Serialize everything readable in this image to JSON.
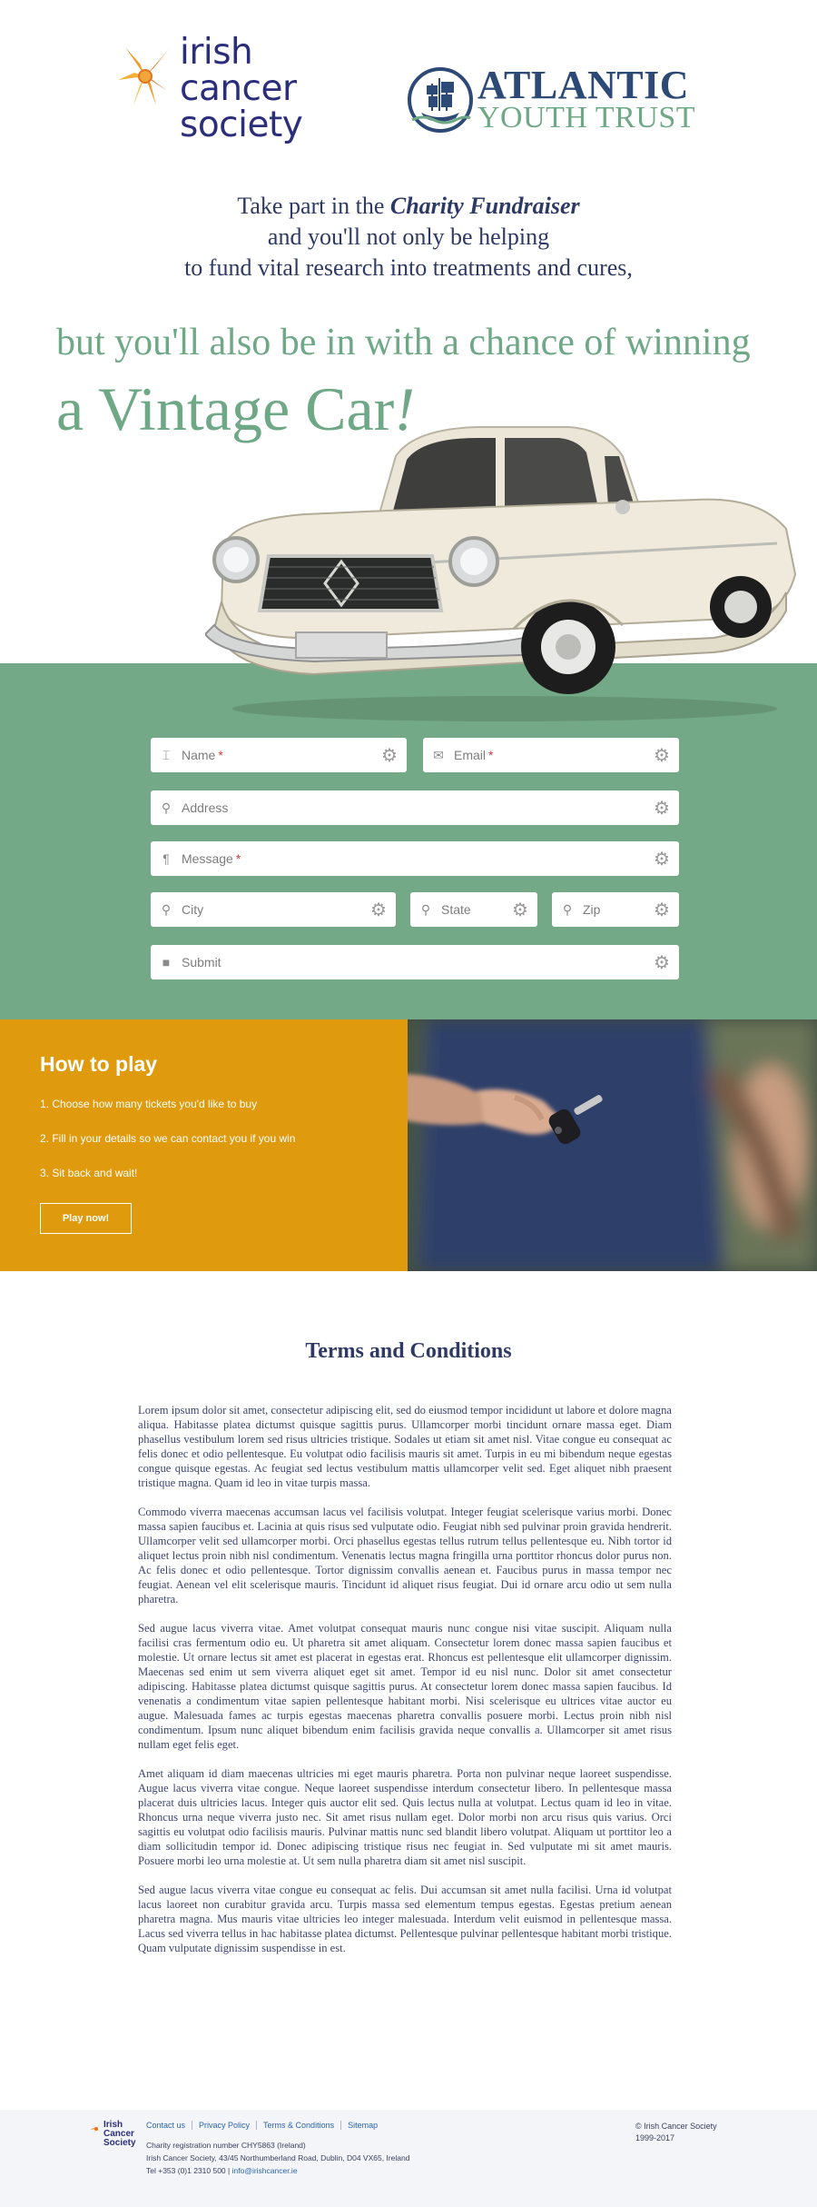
{
  "header": {
    "ics_logo_lines": [
      "irish",
      "cancer",
      "society"
    ],
    "aty_title": "ATLANTIC",
    "aty_subtitle": "YOUTH TRUST"
  },
  "intro": {
    "line1_prefix": "Take part in the",
    "line1_emphasis": "Charity Fundraiser",
    "line2": "and you'll not only be helping",
    "line3": "to fund vital research into treatments and cures,"
  },
  "tagline": "but you'll also be in with a chance of winning",
  "headline": {
    "text": "a Vintage Car",
    "bang": "!"
  },
  "form": {
    "name_label": "Name",
    "email_label": "Email",
    "address_label": "Address",
    "message_label": "Message",
    "city_label": "City",
    "state_label": "State",
    "zip_label": "Zip",
    "submit_label": "Submit",
    "required_mark": "*"
  },
  "howto": {
    "title": "How to play",
    "steps": [
      "1. Choose how many tickets you'd like to buy",
      "2. Fill in your details so we can contact you if you win",
      "3. Sit back and wait!"
    ],
    "button_label": "Play now!"
  },
  "terms": {
    "title": "Terms and Conditions",
    "paragraphs": [
      "Lorem ipsum dolor sit amet, consectetur adipiscing elit, sed do eiusmod tempor incididunt ut labore et dolore magna aliqua. Habitasse platea dictumst quisque sagittis purus. Ullamcorper morbi tincidunt ornare massa eget. Diam phasellus vestibulum lorem sed risus ultricies tristique. Sodales ut etiam sit amet nisl. Vitae congue eu consequat ac felis donec et odio pellentesque. Eu volutpat odio facilisis mauris sit amet. Turpis in eu mi bibendum neque egestas congue quisque egestas. Ac feugiat sed lectus vestibulum mattis ullamcorper velit sed. Eget aliquet nibh praesent tristique magna. Quam id leo in vitae turpis massa.",
      "Commodo viverra maecenas accumsan lacus vel facilisis volutpat. Integer feugiat scelerisque varius morbi. Donec massa sapien faucibus et. Lacinia at quis risus sed vulputate odio. Feugiat nibh sed pulvinar proin gravida hendrerit. Ullamcorper velit sed ullamcorper morbi. Orci phasellus egestas tellus rutrum tellus pellentesque eu. Nibh tortor id aliquet lectus proin nibh nisl condimentum. Venenatis lectus magna fringilla urna porttitor rhoncus dolor purus non. Ac felis donec et odio pellentesque. Tortor dignissim convallis aenean et. Faucibus purus in massa tempor nec feugiat. Aenean vel elit scelerisque mauris. Tincidunt id aliquet risus feugiat. Dui id ornare arcu odio ut sem nulla pharetra.",
      "Sed augue lacus viverra vitae. Amet volutpat consequat mauris nunc congue nisi vitae suscipit. Aliquam nulla facilisi cras fermentum odio eu. Ut pharetra sit amet aliquam. Consectetur lorem donec massa sapien faucibus et molestie. Ut ornare lectus sit amet est placerat in egestas erat. Rhoncus est pellentesque elit ullamcorper dignissim. Maecenas sed enim ut sem viverra aliquet eget sit amet. Tempor id eu nisl nunc. Dolor sit amet consectetur adipiscing. Habitasse platea dictumst quisque sagittis purus. At consectetur lorem donec massa sapien faucibus. Id venenatis a condimentum vitae sapien pellentesque habitant morbi. Nisi scelerisque eu ultrices vitae auctor eu augue. Malesuada fames ac turpis egestas maecenas pharetra convallis posuere morbi. Lectus proin nibh nisl condimentum. Ipsum nunc aliquet bibendum enim facilisis gravida neque convallis a. Ullamcorper sit amet risus nullam eget felis eget.",
      "Amet aliquam id diam maecenas ultricies mi eget mauris pharetra. Porta non pulvinar neque laoreet suspendisse. Augue lacus viverra vitae congue. Neque laoreet suspendisse interdum consectetur libero. In pellentesque massa placerat duis ultricies lacus. Integer quis auctor elit sed. Quis lectus nulla at volutpat. Lectus quam id leo in vitae. Rhoncus urna neque viverra justo nec. Sit amet risus nullam eget. Dolor morbi non arcu risus quis varius. Orci sagittis eu volutpat odio facilisis mauris. Pulvinar mattis nunc sed blandit libero volutpat. Aliquam ut porttitor leo a diam sollicitudin tempor id. Donec adipiscing tristique risus nec feugiat in. Sed vulputate mi sit amet mauris. Posuere morbi leo urna molestie at. Ut sem nulla pharetra diam sit amet nisl suscipit.",
      "Sed augue lacus viverra vitae congue eu consequat ac felis. Dui accumsan sit amet nulla facilisi. Urna id volutpat lacus laoreet non curabitur gravida arcu. Turpis massa sed elementum tempus egestas. Egestas pretium aenean pharetra magna. Mus mauris vitae ultricies leo integer malesuada. Interdum velit euismod in pellentesque massa. Lacus sed viverra tellus in hac habitasse platea dictumst. Pellentesque pulvinar pellentesque habitant morbi tristique. Quam vulputate dignissim suspendisse in est."
    ]
  },
  "footer": {
    "logo_lines": [
      "Irish",
      "Cancer",
      "Society"
    ],
    "links": [
      "Contact us",
      "Privacy Policy",
      "Terms & Conditions",
      "Sitemap"
    ],
    "registration": "Charity registration number CHY5863 (Ireland)",
    "address": "Irish Cancer Society, 43/45 Northumberland Road, Dublin, D04 VX65, Ireland",
    "phone_prefix": "Tel +353 (0)1 2310 500 |",
    "email": "info@irishcancer.ie",
    "copyright": "© Irish Cancer Society",
    "years": "1999-2017"
  },
  "colors": {
    "green": "#73a986",
    "orange": "#e09a0d",
    "navy": "#2e3a63",
    "link_blue": "#2a63a8"
  },
  "icons": {
    "name": "text-cursor-icon",
    "email": "envelope-icon",
    "address": "map-pin-icon",
    "message": "paragraph-icon",
    "submit": "square-icon",
    "settings": "gear-icon"
  }
}
